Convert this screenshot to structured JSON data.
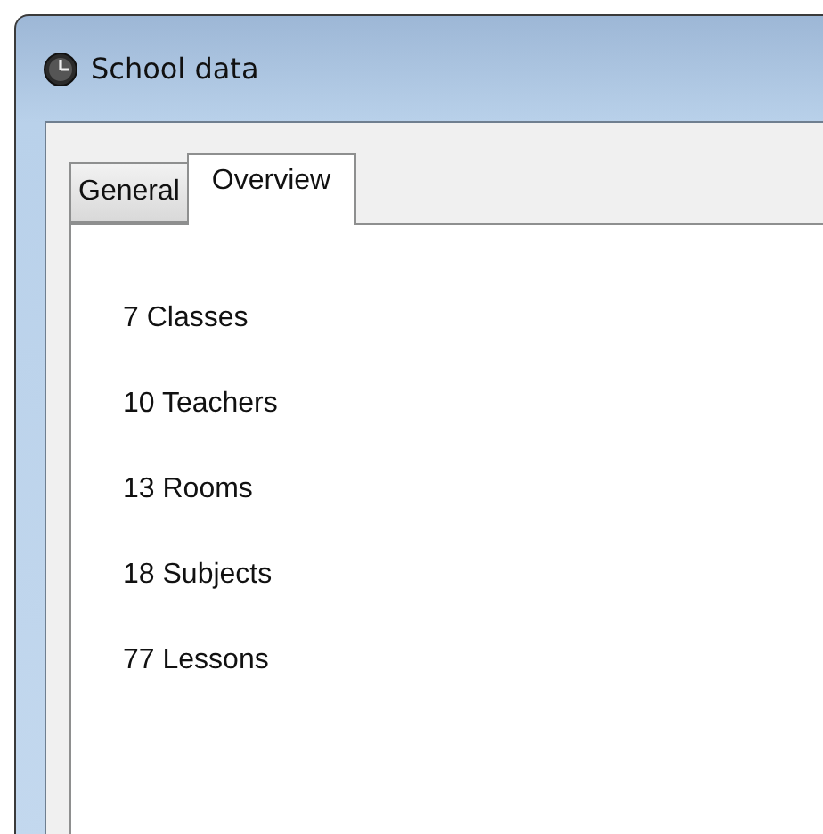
{
  "window": {
    "title": "School data"
  },
  "tabs": [
    {
      "label": "General",
      "selected": false
    },
    {
      "label": "Overview",
      "selected": true
    }
  ],
  "overview_items": [
    "7 Classes",
    "10 Teachers",
    "13 Rooms",
    "18 Subjects",
    "77 Lessons"
  ]
}
